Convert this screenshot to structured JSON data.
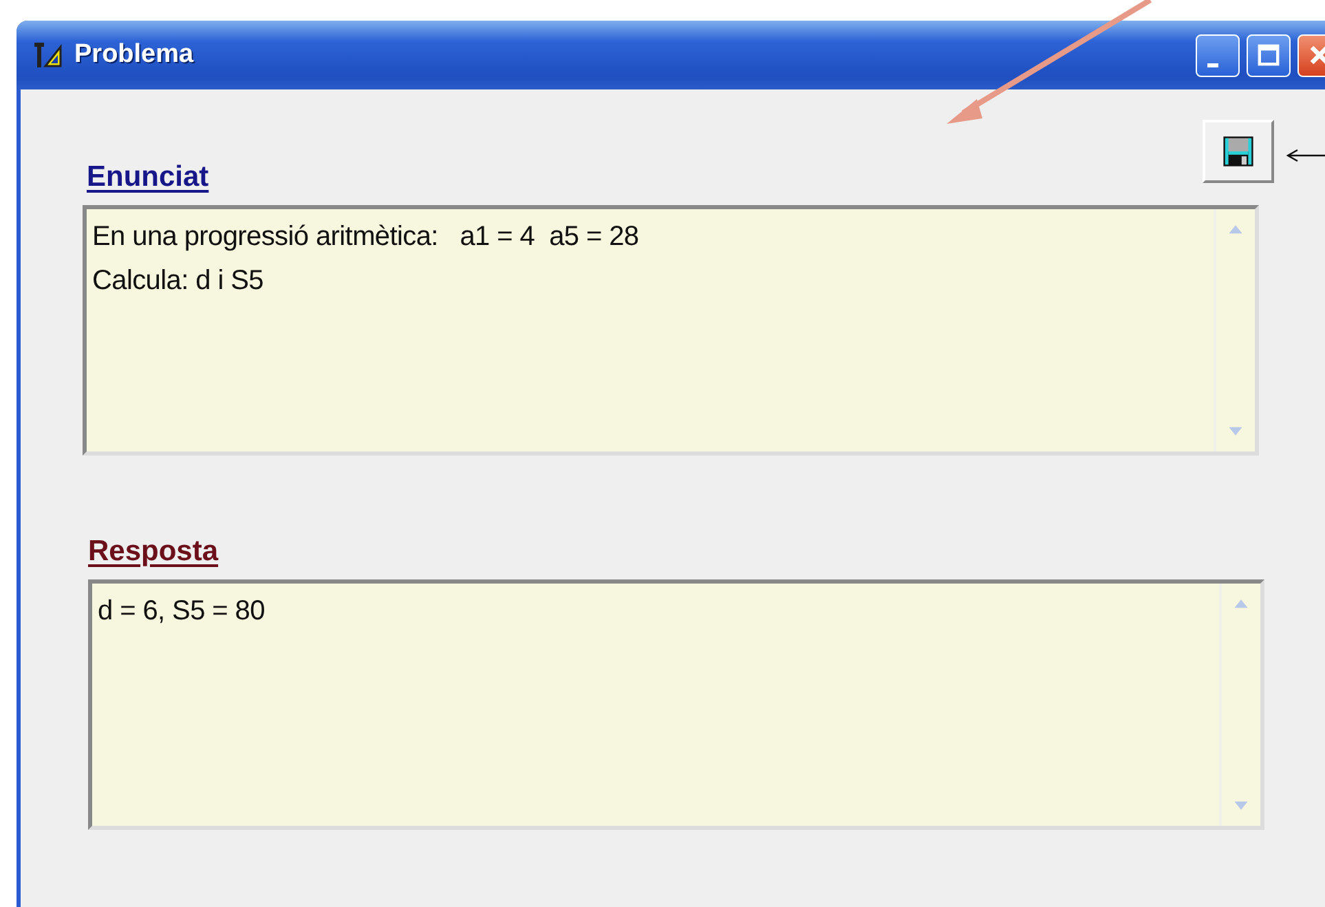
{
  "window": {
    "title": "Problema"
  },
  "sections": [
    {
      "label": "Enunciat",
      "color": "#17178a",
      "text": "En una progressió aritmètica:   a1 = 4  a5 = 28\nCalcula: d i S5"
    },
    {
      "label": "Resposta",
      "color": "#6b0f1a",
      "text": "d = 6, S5 = 80"
    }
  ]
}
